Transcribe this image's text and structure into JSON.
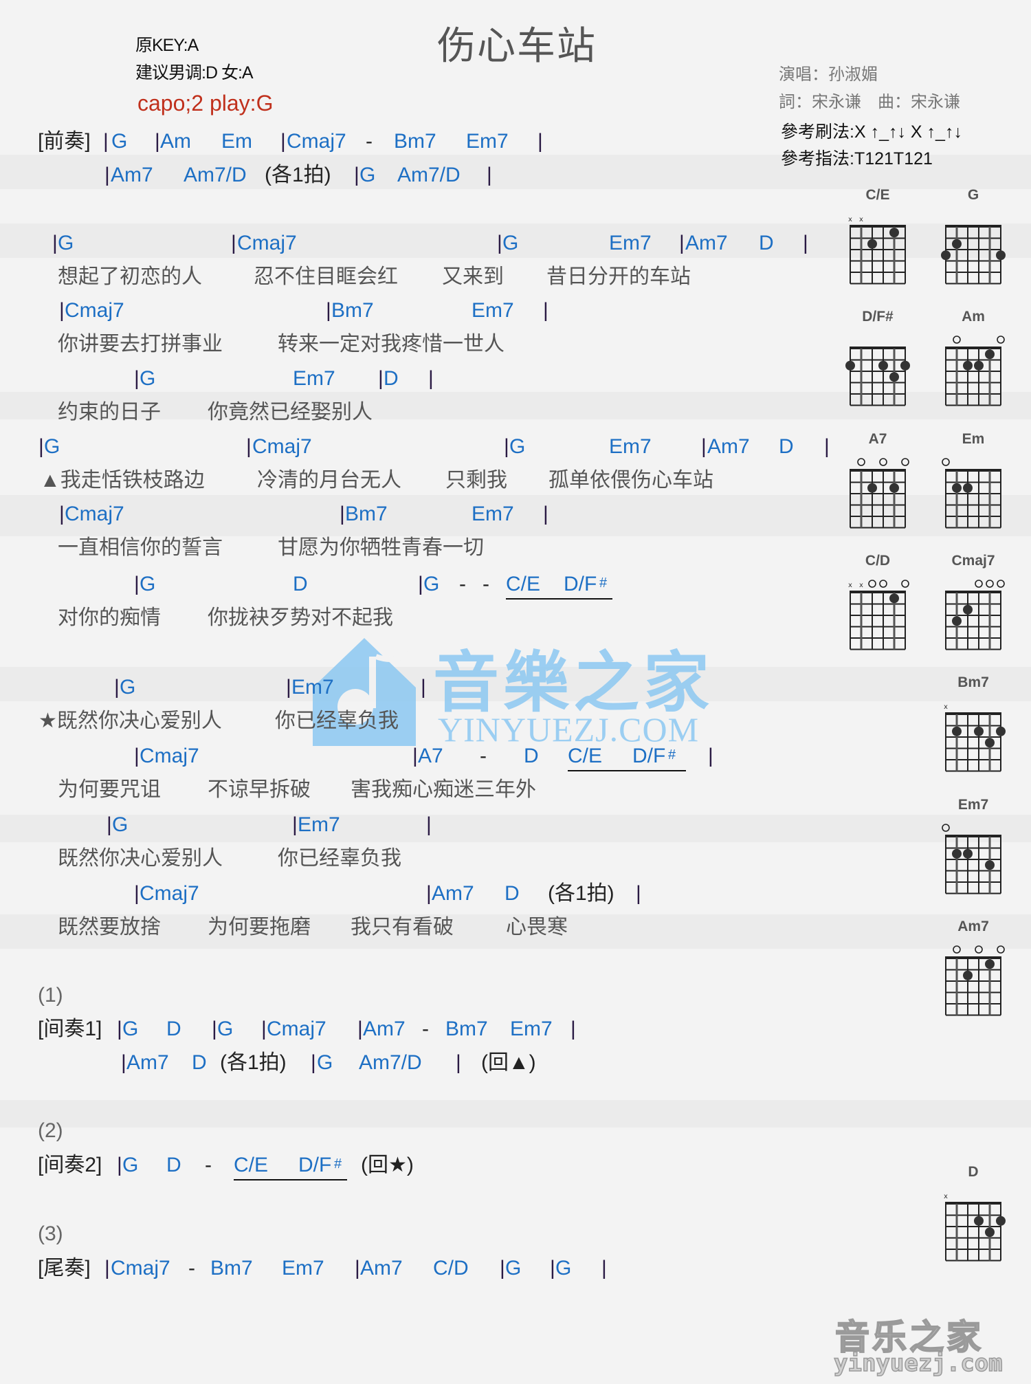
{
  "header": {
    "title": "伤心车站",
    "original_key": "原KEY:A",
    "suggested_key": "建议男调:D 女:A",
    "capo": "capo;2 play:G",
    "singer": "演唱：孙淑媚",
    "credits": "詞：宋永谦　曲：宋永谦",
    "strum": "參考刷法:X ↑_↑↓ X ↑_↑↓",
    "picking": "參考指法:T121T121"
  },
  "colors": {
    "chord": "#1d6fc4",
    "capo": "#c0301c",
    "lyric": "#555555",
    "watermark": "#8cc8f2"
  },
  "intro": {
    "label": "[前奏]",
    "line1": [
      "|",
      "G",
      "|",
      "Am",
      "Em",
      "|",
      "Cmaj7",
      "-",
      "Bm7",
      "Em7",
      "|"
    ],
    "line2": [
      "|",
      "Am7",
      "Am7/D",
      "(各1拍)",
      "|",
      "G",
      "Am7/D",
      "|"
    ]
  },
  "verse": [
    {
      "chords": [
        "|",
        "G",
        "|",
        "Cmaj7",
        "|",
        "G",
        "Em7",
        "|",
        "Am7",
        "D",
        "|"
      ],
      "lyric": [
        "想起了初恋的人",
        "忍不住目眶会红",
        "又来到",
        "昔日分开的车站"
      ]
    },
    {
      "chords": [
        "|",
        "Cmaj7",
        "|",
        "Bm7",
        "Em7",
        "|"
      ],
      "lyric": [
        "你讲要去打拼事业",
        "转来一定对我疼惜一世人"
      ]
    },
    {
      "chords": [
        "|",
        "G",
        "Em7",
        "|",
        "D",
        "|"
      ],
      "lyric": [
        "约束的日子",
        "你竟然已经娶别人"
      ]
    },
    {
      "chords": [
        "|",
        "G",
        "|",
        "Cmaj7",
        "|",
        "G",
        "Em7",
        "|",
        "Am7",
        "D",
        "|"
      ],
      "lyric": [
        "▲我走恬铁枝路边",
        "冷清的月台无人",
        "只剩我",
        "孤单依偎伤心车站"
      ]
    },
    {
      "chords": [
        "|",
        "Cmaj7",
        "|",
        "Bm7",
        "Em7",
        "|"
      ],
      "lyric": [
        "一直相信你的誓言",
        "甘愿为你牺牲青春一切"
      ]
    },
    {
      "chords": [
        "|",
        "G",
        "D",
        "|",
        "G",
        "-",
        "-",
        "C/E",
        "D/F",
        "#"
      ],
      "lyric": [
        "对你的痴情",
        "你拢袂歹势对不起我"
      ]
    }
  ],
  "chorus": [
    {
      "chords": [
        "|",
        "G",
        "|",
        "Em7",
        "|"
      ],
      "lyric": [
        "★既然你决心爱别人",
        "你已经辜负我"
      ]
    },
    {
      "chords": [
        "|",
        "Cmaj7",
        "|",
        "A7",
        "-",
        "D",
        "C/E",
        "D/F",
        "#",
        "|"
      ],
      "lyric": [
        "为何要咒诅",
        "不谅早拆破",
        "害我痴心痴迷三年外"
      ]
    },
    {
      "chords": [
        "|",
        "G",
        "|",
        "Em7",
        "|"
      ],
      "lyric": [
        "既然你决心爱别人",
        "你已经辜负我"
      ]
    },
    {
      "chords": [
        "|",
        "Cmaj7",
        "|",
        "Am7",
        "D",
        "(各1拍)",
        "|"
      ],
      "lyric": [
        "既然要放捨",
        "为何要拖磨",
        "我只有看破",
        "心畏寒"
      ]
    }
  ],
  "interlude1": {
    "num": "(1)",
    "label": "[间奏1]",
    "line1": [
      "|",
      "G",
      "D",
      "|",
      "G",
      "|",
      "Cmaj7",
      "|",
      "Am7",
      "-",
      "Bm7",
      "Em7",
      "|"
    ],
    "line2": [
      "|",
      "Am7",
      "D",
      "(各1拍)",
      "|",
      "G",
      "Am7/D",
      "|",
      "(回▲)"
    ]
  },
  "interlude2": {
    "num": "(2)",
    "label": "[间奏2]",
    "line1": [
      "|",
      "G",
      "D",
      "-",
      "C/E",
      "D/F",
      "#",
      "(回★)"
    ]
  },
  "outro": {
    "num": "(3)",
    "label": "[尾奏]",
    "line1": [
      "|",
      "Cmaj7",
      "-",
      "Bm7",
      "Em7",
      "|",
      "Am7",
      "C/D",
      "|",
      "G",
      "|",
      "G",
      "|"
    ]
  },
  "chord_diagrams": [
    {
      "name": "C/E",
      "top": [
        "x",
        "x",
        "",
        "",
        "",
        ""
      ],
      "dots": [
        [
          3,
          2
        ],
        [
          5,
          1
        ]
      ]
    },
    {
      "name": "G",
      "top": [
        "",
        "",
        "",
        "",
        "",
        ""
      ],
      "dots": [
        [
          1,
          3
        ],
        [
          2,
          2
        ],
        [
          6,
          3
        ]
      ]
    },
    {
      "name": "D/F#",
      "top": [
        "",
        "",
        "",
        "",
        "",
        ""
      ],
      "dots": [
        [
          1,
          2
        ],
        [
          4,
          2
        ],
        [
          6,
          2
        ],
        [
          5,
          3
        ]
      ]
    },
    {
      "name": "Am",
      "top": [
        "",
        "o",
        "",
        "",
        "",
        "o"
      ],
      "dots": [
        [
          3,
          2
        ],
        [
          4,
          2
        ],
        [
          5,
          1
        ]
      ]
    },
    {
      "name": "A7",
      "top": [
        "",
        "o",
        "",
        "o",
        "",
        "o"
      ],
      "dots": [
        [
          3,
          2
        ],
        [
          5,
          2
        ]
      ]
    },
    {
      "name": "Em",
      "top": [
        "o",
        "",
        "",
        "",
        "",
        ""
      ],
      "dots": [
        [
          2,
          2
        ],
        [
          3,
          2
        ]
      ]
    },
    {
      "name": "C/D",
      "top": [
        "x",
        "x",
        "o",
        "o",
        "",
        "o"
      ],
      "dots": [
        [
          5,
          1
        ]
      ]
    },
    {
      "name": "Cmaj7",
      "top": [
        "",
        "",
        "",
        "o",
        "o",
        "o"
      ],
      "dots": [
        [
          2,
          3
        ],
        [
          3,
          2
        ]
      ]
    },
    {
      "name": "Bm7",
      "top": [
        "x",
        "",
        "",
        "",
        "",
        ""
      ],
      "dots": [
        [
          2,
          2
        ],
        [
          4,
          2
        ],
        [
          6,
          2
        ],
        [
          5,
          3
        ]
      ]
    },
    {
      "name": "Em7",
      "top": [
        "o",
        "",
        "",
        "",
        "",
        ""
      ],
      "dots": [
        [
          2,
          2
        ],
        [
          3,
          2
        ],
        [
          5,
          3
        ]
      ]
    },
    {
      "name": "Am7",
      "top": [
        "",
        "o",
        "",
        "o",
        "",
        "o"
      ],
      "dots": [
        [
          3,
          2
        ],
        [
          5,
          1
        ]
      ]
    },
    {
      "name": "D",
      "top": [
        "x",
        "",
        "",
        "",
        "",
        ""
      ],
      "dots": [
        [
          4,
          2
        ],
        [
          6,
          2
        ],
        [
          5,
          3
        ]
      ]
    }
  ],
  "watermark": {
    "cn": "音樂之家",
    "en": "YINYUEZJ.COM"
  },
  "footer_logo": {
    "cn": "音乐之家",
    "en": "yinyuezj.com"
  }
}
